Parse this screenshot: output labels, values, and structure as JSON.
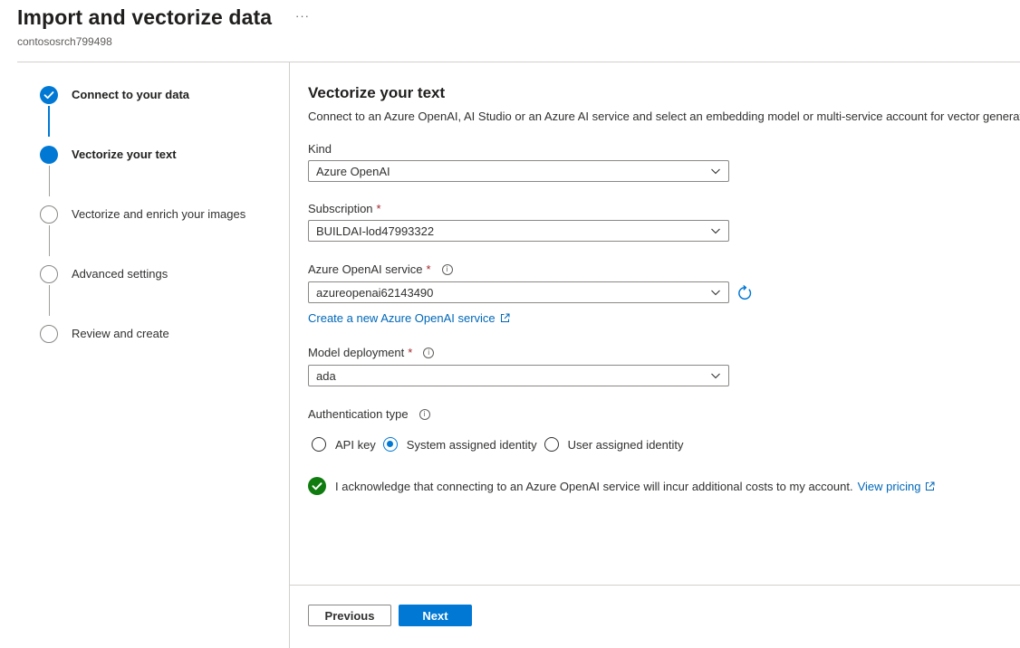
{
  "page": {
    "title": "Import and vectorize data",
    "more": "···",
    "subtitle": "contososrch799498"
  },
  "steps": [
    {
      "label": "Connect to your data",
      "state": "done"
    },
    {
      "label": "Vectorize your text",
      "state": "current"
    },
    {
      "label": "Vectorize and enrich your images",
      "state": "todo"
    },
    {
      "label": "Advanced settings",
      "state": "todo"
    },
    {
      "label": "Review and create",
      "state": "todo"
    }
  ],
  "main": {
    "title": "Vectorize your text",
    "description": "Connect to an Azure OpenAI, AI Studio or an Azure AI service and select an embedding model or multi-service account for vector generat",
    "kind": {
      "label": "Kind",
      "value": "Azure OpenAI"
    },
    "subscription": {
      "label": "Subscription",
      "required": "*",
      "value": "BUILDAI-lod47993322"
    },
    "openai_service": {
      "label": "Azure OpenAI service",
      "required": "*",
      "value": "azureopenai62143490"
    },
    "create_link": "Create a new Azure OpenAI service",
    "model_deployment": {
      "label": "Model deployment",
      "required": "*",
      "value": "ada"
    },
    "auth": {
      "label": "Authentication type",
      "options": [
        "API key",
        "System assigned identity",
        "User assigned identity"
      ],
      "selected": "System assigned identity"
    },
    "acknowledge": {
      "text": "I acknowledge that connecting to an Azure OpenAI service will incur additional costs to my account.",
      "link": "View pricing"
    }
  },
  "footer": {
    "previous": "Previous",
    "next": "Next"
  },
  "colors": {
    "accent": "#0078d4",
    "link": "#0067b8",
    "success": "#107c10",
    "required": "#a4262c"
  }
}
